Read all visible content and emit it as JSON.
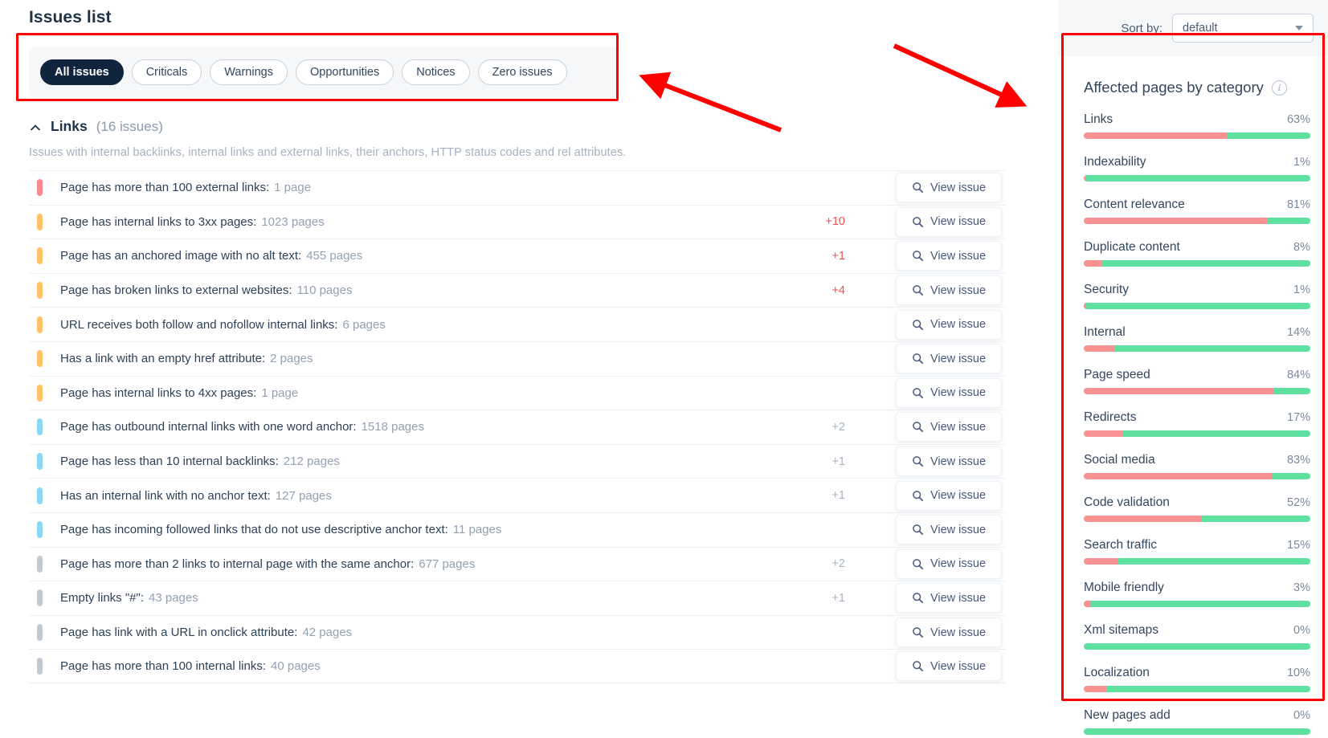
{
  "page_title": "Issues list",
  "filters": {
    "items": [
      {
        "label": "All issues",
        "active": true
      },
      {
        "label": "Criticals",
        "active": false
      },
      {
        "label": "Warnings",
        "active": false
      },
      {
        "label": "Opportunities",
        "active": false
      },
      {
        "label": "Notices",
        "active": false
      },
      {
        "label": "Zero issues",
        "active": false
      }
    ]
  },
  "section": {
    "name": "Links",
    "count": "(16 issues)",
    "description": "Issues with internal backlinks, internal links and external links, their anchors, HTTP status codes and rel attributes.",
    "collapse_icon": "chevron-up-icon"
  },
  "view_issue_label": "View issue",
  "issues": [
    {
      "severity": "critical",
      "text": "Page has more than 100 external links:",
      "count": "1 page",
      "delta": "",
      "delta_kind": ""
    },
    {
      "severity": "warning",
      "text": "Page has internal links to 3xx pages:",
      "count": "1023 pages",
      "delta": "+10",
      "delta_kind": "up"
    },
    {
      "severity": "warning",
      "text": "Page has an anchored image with no alt text:",
      "count": "455 pages",
      "delta": "+1",
      "delta_kind": "up"
    },
    {
      "severity": "warning",
      "text": "Page has broken links to external websites:",
      "count": "110 pages",
      "delta": "+4",
      "delta_kind": "up"
    },
    {
      "severity": "warning",
      "text": "URL receives both follow and nofollow internal links:",
      "count": "6 pages",
      "delta": "",
      "delta_kind": ""
    },
    {
      "severity": "warning",
      "text": "Has a link with an empty href attribute:",
      "count": "2 pages",
      "delta": "",
      "delta_kind": ""
    },
    {
      "severity": "warning",
      "text": "Page has internal links to 4xx pages:",
      "count": "1 page",
      "delta": "",
      "delta_kind": ""
    },
    {
      "severity": "notice",
      "text": "Page has outbound internal links with one word anchor:",
      "count": "1518 pages",
      "delta": "+2",
      "delta_kind": "neu"
    },
    {
      "severity": "notice",
      "text": "Page has less than 10 internal backlinks:",
      "count": "212 pages",
      "delta": "+1",
      "delta_kind": "neu"
    },
    {
      "severity": "notice",
      "text": "Has an internal link with no anchor text:",
      "count": "127 pages",
      "delta": "+1",
      "delta_kind": "neu"
    },
    {
      "severity": "notice",
      "text": "Page has incoming followed links that do not use descriptive anchor text:",
      "count": "11 pages",
      "delta": "",
      "delta_kind": ""
    },
    {
      "severity": "zero",
      "text": "Page has more than 2 links to internal page with the same anchor:",
      "count": "677 pages",
      "delta": "+2",
      "delta_kind": "neu"
    },
    {
      "severity": "zero",
      "text": "Empty links \"#\":",
      "count": "43 pages",
      "delta": "+1",
      "delta_kind": "neu"
    },
    {
      "severity": "zero",
      "text": "Page has link with a URL in onclick attribute:",
      "count": "42 pages",
      "delta": "",
      "delta_kind": ""
    },
    {
      "severity": "zero",
      "text": "Page has more than 100 internal links:",
      "count": "40 pages",
      "delta": "",
      "delta_kind": ""
    }
  ],
  "sidebar": {
    "sort_label": "Sort by:",
    "sort_value": "default",
    "sort_icon": "chevron-down-icon",
    "categories_title": "Affected pages by category",
    "info_icon": "info-icon",
    "categories": [
      {
        "name": "Links",
        "pct": "63%",
        "value": 63
      },
      {
        "name": "Indexability",
        "pct": "1%",
        "value": 1
      },
      {
        "name": "Content relevance",
        "pct": "81%",
        "value": 81
      },
      {
        "name": "Duplicate content",
        "pct": "8%",
        "value": 8
      },
      {
        "name": "Security",
        "pct": "1%",
        "value": 1
      },
      {
        "name": "Internal",
        "pct": "14%",
        "value": 14
      },
      {
        "name": "Page speed",
        "pct": "84%",
        "value": 84
      },
      {
        "name": "Redirects",
        "pct": "17%",
        "value": 17
      },
      {
        "name": "Social media",
        "pct": "83%",
        "value": 83
      },
      {
        "name": "Code validation",
        "pct": "52%",
        "value": 52
      },
      {
        "name": "Search traffic",
        "pct": "15%",
        "value": 15
      },
      {
        "name": "Mobile friendly",
        "pct": "3%",
        "value": 3
      },
      {
        "name": "Xml sitemaps",
        "pct": "0%",
        "value": 0
      },
      {
        "name": "Localization",
        "pct": "10%",
        "value": 10
      },
      {
        "name": "New pages add",
        "pct": "0%",
        "value": 0
      }
    ]
  },
  "colors": {
    "critical": "#fd8a8a",
    "warning": "#ffc266",
    "notice": "#8ad6f5",
    "zero": "#c3c9d1",
    "bar_red": "#fb9292",
    "bar_green": "#5ee0a0",
    "accent_dark": "#10243e",
    "annotation": "#ff0000"
  }
}
